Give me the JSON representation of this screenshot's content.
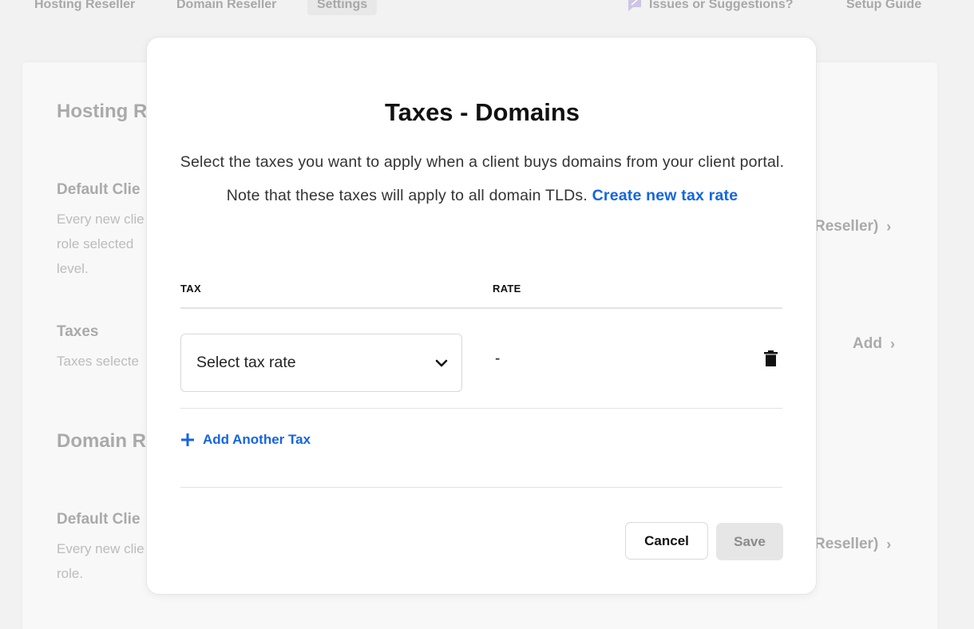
{
  "topnav": {
    "items": [
      "Hosting Reseller",
      "Domain Reseller",
      "Settings"
    ],
    "issues_label": "Issues or Suggestions?",
    "setup_label": "Setup Guide"
  },
  "background": {
    "hosting_heading": "Hosting R",
    "default_client_heading": "Default Clie",
    "default_client_desc": [
      "Every new clie",
      "role selected",
      "level."
    ],
    "default_client_link": "Reseller)",
    "taxes_heading": "Taxes",
    "taxes_desc": "Taxes selecte",
    "taxes_link": "Add",
    "domain_heading": "Domain R",
    "domain_default_heading": "Default Clie",
    "domain_default_desc": [
      "Every new clie",
      "role."
    ],
    "domain_default_link": "Reseller)"
  },
  "modal": {
    "title": "Taxes - Domains",
    "description": "Select the taxes you want to apply when a client buys domains from your client portal. Note that these taxes will apply to all domain TLDs. ",
    "create_link": "Create new tax rate",
    "columns": {
      "tax": "TAX",
      "rate": "RATE"
    },
    "rows": [
      {
        "select_placeholder": "Select tax rate",
        "rate": "-"
      }
    ],
    "add_another": "Add Another Tax",
    "cancel_label": "Cancel",
    "save_label": "Save"
  },
  "colors": {
    "accent": "#1565e0",
    "overlay_bg": "#f2f2f2",
    "save_disabled_bg": "#e6e6e6"
  }
}
